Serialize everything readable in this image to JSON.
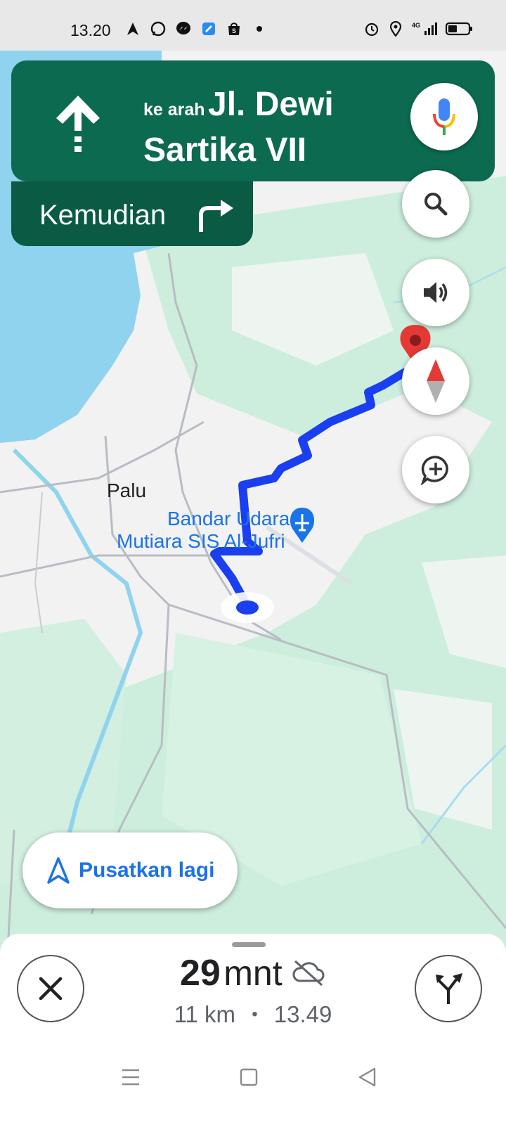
{
  "status_bar": {
    "time": "13.20",
    "network": "4G",
    "left_icons": [
      "navigation-icon",
      "whatsapp-icon",
      "messenger-icon",
      "app-icon",
      "shopee-icon",
      "dot-icon"
    ],
    "right_icons": [
      "alarm-icon",
      "location-icon",
      "signal-icon",
      "battery-icon"
    ]
  },
  "navigation": {
    "prefix": "ke arah",
    "street": "Jl. Dewi Sartika VII",
    "then_label": "Kemudian",
    "maneuver_icon": "straight-arrow-icon",
    "then_icon": "turn-right-icon"
  },
  "map": {
    "city_label": "Palu",
    "airport_label_line1": "Bandar Udara",
    "airport_label_line2": "Mutiara SIS Al-Jufri",
    "colors": {
      "water": "#8fd3ee",
      "land": "#f2f2f2",
      "green": "#cdeedd",
      "route": "#1a3ff0",
      "road": "#b8bcc4"
    }
  },
  "actions": {
    "recenter_label": "Pusatkan lagi"
  },
  "trip": {
    "duration_value": "29",
    "duration_unit": "mnt",
    "distance": "11 km",
    "separator": "•",
    "arrival": "13.49"
  },
  "colors": {
    "nav_green": "#0b6a4f",
    "nav_green_dark": "#0b5a43",
    "accent_blue": "#1a73e8"
  }
}
